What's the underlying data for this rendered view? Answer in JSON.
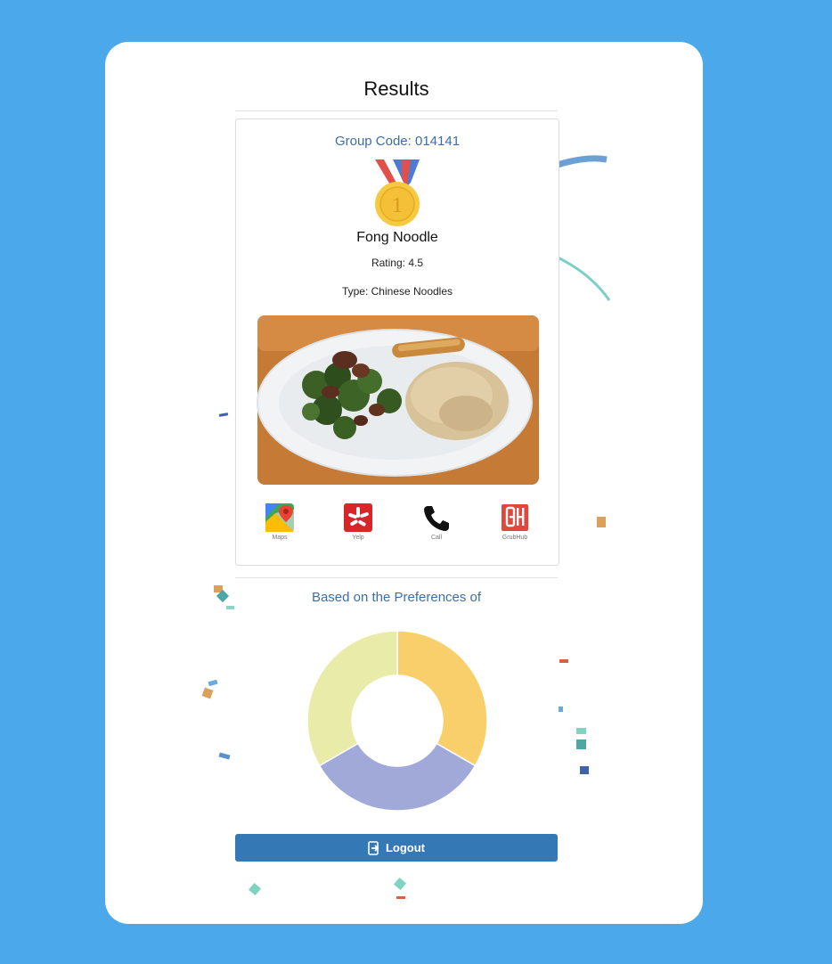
{
  "page": {
    "title": "Results"
  },
  "result": {
    "group_code": "Group Code: 014141",
    "restaurant_name": "Fong Noodle",
    "rating": "Rating: 4.5",
    "type": "Type: Chinese Noodles",
    "medal_rank": "1"
  },
  "links": [
    {
      "label": "Maps",
      "icon": "google-maps-icon"
    },
    {
      "label": "Yelp",
      "icon": "yelp-icon"
    },
    {
      "label": "Call",
      "icon": "phone-icon"
    },
    {
      "label": "GrubHub",
      "icon": "grubhub-icon"
    }
  ],
  "preferences": {
    "title": "Based on the Preferences of"
  },
  "chart_data": {
    "type": "pie",
    "donut": true,
    "values": [
      1,
      1,
      1
    ],
    "colors": [
      "#f8cf6b",
      "#a1a9d9",
      "#e9eca8"
    ]
  },
  "logout": {
    "label": "Logout",
    "icon": "logout-icon"
  },
  "colors": {
    "background": "#4ba8ea",
    "accent": "#3d6ea6",
    "button": "#3479b6",
    "yelp": "#d8252a",
    "grubhub": "#e0483d"
  }
}
